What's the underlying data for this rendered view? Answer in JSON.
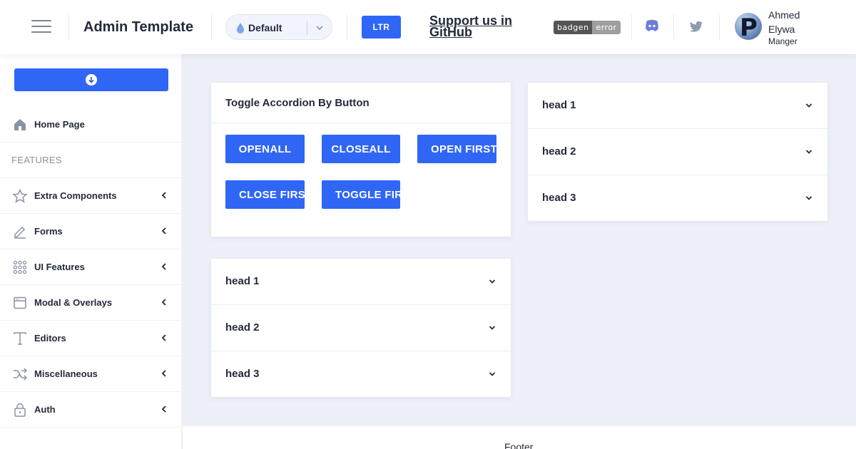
{
  "header": {
    "title": "Admin Template",
    "theme_select": {
      "value": "Default"
    },
    "direction_button": "LTR",
    "support_link": "Support us in GitHub",
    "badge": {
      "left": "badgen",
      "right": "error"
    },
    "user": {
      "name": "Ahmed Elywa",
      "role": "Manger",
      "avatar_letter": "P"
    }
  },
  "sidebar": {
    "home": "Home Page",
    "section_label": "FEATURES",
    "items": [
      {
        "label": "Extra Components",
        "icon": "star-icon"
      },
      {
        "label": "Forms",
        "icon": "pencil-icon"
      },
      {
        "label": "UI Features",
        "icon": "grid-dots-icon"
      },
      {
        "label": "Modal & Overlays",
        "icon": "window-icon"
      },
      {
        "label": "Editors",
        "icon": "text-icon"
      },
      {
        "label": "Miscellaneous",
        "icon": "shuffle-icon"
      },
      {
        "label": "Auth",
        "icon": "lock-icon"
      }
    ]
  },
  "toggle_card": {
    "title": "Toggle Accordion By Button",
    "buttons": [
      "OPENALL",
      "CLOSEALL",
      "OPEN FIRST",
      "CLOSE FIRST",
      "TOGGLE FIRST"
    ]
  },
  "accordion_left": {
    "items": [
      "head 1",
      "head 2",
      "head 3"
    ]
  },
  "accordion_right": {
    "items": [
      "head 1",
      "head 2",
      "head 3"
    ]
  },
  "footer": {
    "text": "Footer"
  },
  "colors": {
    "primary": "#2f66f6",
    "background": "#eef0f8",
    "text": "#232a3b",
    "muted": "#8a90a0"
  }
}
